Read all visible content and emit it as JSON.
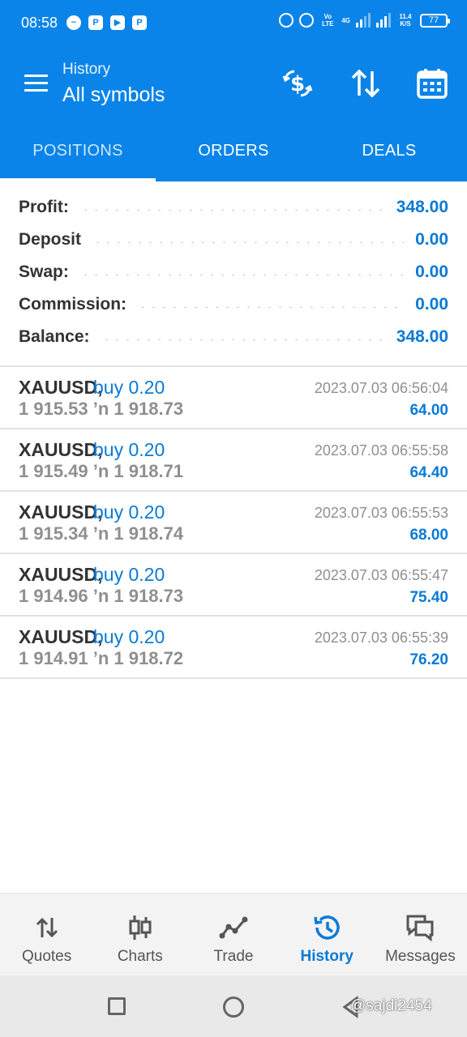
{
  "status_bar": {
    "time": "08:58",
    "network_tag": "Vo LTE",
    "net_gen": "4G",
    "speed": "11.4 K/S",
    "battery": "77"
  },
  "header": {
    "title_small": "History",
    "title_big": "All symbols"
  },
  "tabs": [
    {
      "label": "POSITIONS",
      "active": true
    },
    {
      "label": "ORDERS",
      "active": false
    },
    {
      "label": "DEALS",
      "active": false
    }
  ],
  "summary": [
    {
      "label": "Profit:",
      "value": "348.00"
    },
    {
      "label": "Deposit",
      "value": "0.00"
    },
    {
      "label": "Swap:",
      "value": "0.00"
    },
    {
      "label": "Commission:",
      "value": "0.00"
    },
    {
      "label": "Balance:",
      "value": "348.00"
    }
  ],
  "positions": [
    {
      "symbol": "XAUUSD,",
      "type": "buy 0.20",
      "prices": "1 915.53 ’n  1 918.73",
      "time": "2023.07.03 06:56:04",
      "profit": "64.00"
    },
    {
      "symbol": "XAUUSD,",
      "type": "buy 0.20",
      "prices": "1 915.49 ’n  1 918.71",
      "time": "2023.07.03 06:55:58",
      "profit": "64.40"
    },
    {
      "symbol": "XAUUSD,",
      "type": "buy 0.20",
      "prices": "1 915.34 ’n  1 918.74",
      "time": "2023.07.03 06:55:53",
      "profit": "68.00"
    },
    {
      "symbol": "XAUUSD,",
      "type": "buy 0.20",
      "prices": "1 914.96 ’n  1 918.73",
      "time": "2023.07.03 06:55:47",
      "profit": "75.40"
    },
    {
      "symbol": "XAUUSD,",
      "type": "buy 0.20",
      "prices": "1 914.91 ’n  1 918.72",
      "time": "2023.07.03 06:55:39",
      "profit": "76.20"
    }
  ],
  "bottom_nav": [
    {
      "label": "Quotes",
      "icon": "quotes-arrows-icon",
      "active": false
    },
    {
      "label": "Charts",
      "icon": "candlestick-icon",
      "active": false
    },
    {
      "label": "Trade",
      "icon": "trade-line-icon",
      "active": false
    },
    {
      "label": "History",
      "icon": "history-clock-icon",
      "active": true
    },
    {
      "label": "Messages",
      "icon": "chat-bubbles-icon",
      "active": false
    }
  ],
  "watermark": "@sajdi2454",
  "colors": {
    "primary": "#0a84e8",
    "accent_text": "#0a7ad6",
    "muted_text": "#8f8f8f",
    "nav_bg": "#f3f3f3"
  }
}
